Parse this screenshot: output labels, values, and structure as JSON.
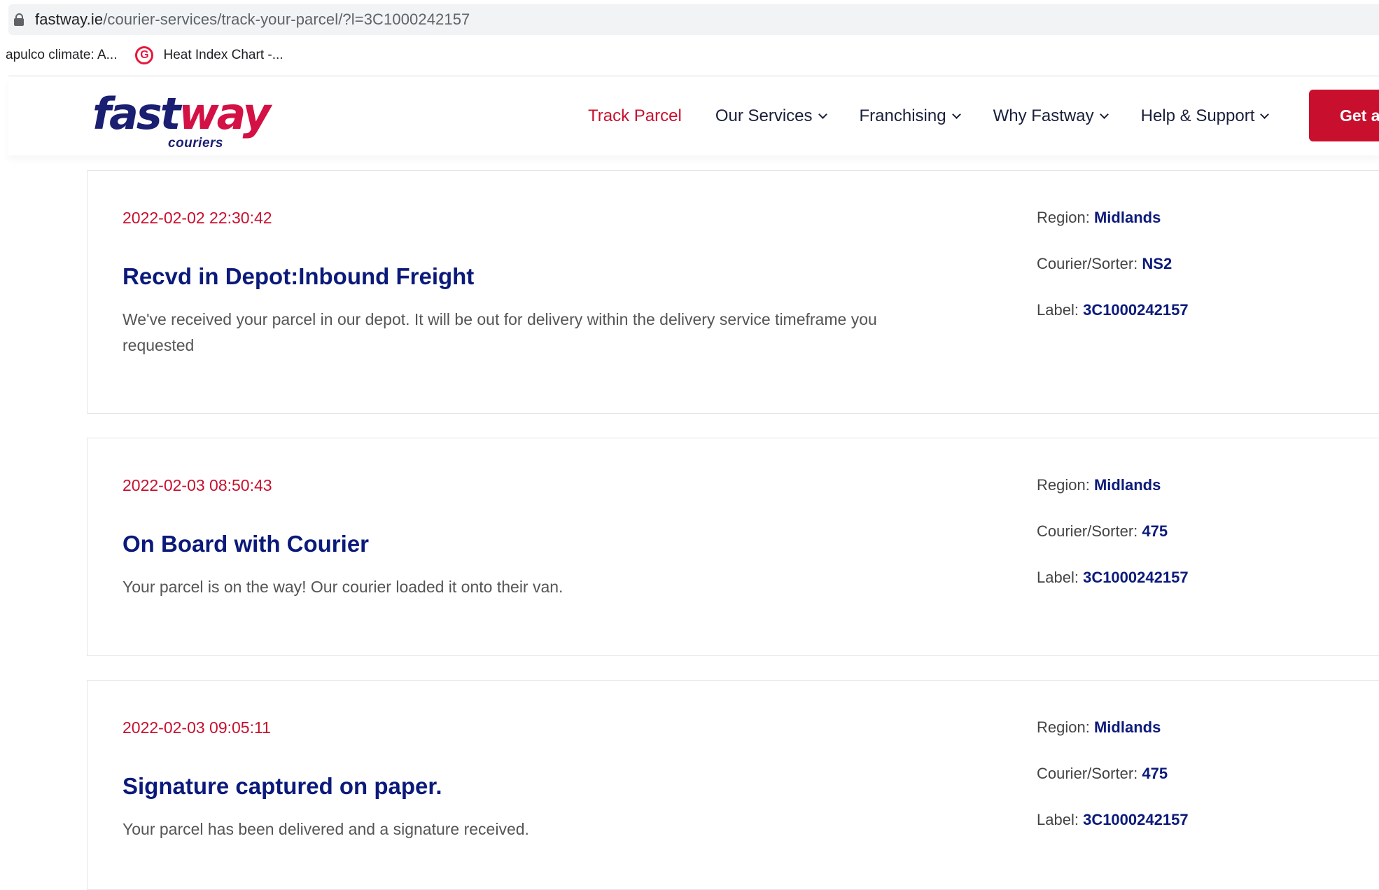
{
  "browser": {
    "url_domain": "fastway.ie",
    "url_path": "/courier-services/track-your-parcel/?l=3C1000242157",
    "bookmarks": [
      {
        "label": "apulco climate: A..."
      },
      {
        "label": "Heat Index Chart -..."
      }
    ]
  },
  "header": {
    "logo_word_a": "fast",
    "logo_word_b": "way",
    "logo_sub": "couriers",
    "nav": [
      {
        "label": "Track Parcel",
        "active": true
      },
      {
        "label": "Our Services",
        "dropdown": true
      },
      {
        "label": "Franchising",
        "dropdown": true
      },
      {
        "label": "Why Fastway",
        "dropdown": true
      },
      {
        "label": "Help & Support",
        "dropdown": true
      }
    ],
    "cta_label": "Get a"
  },
  "labels": {
    "region": "Region:",
    "courier": "Courier/Sorter:",
    "label": "Label:"
  },
  "events": [
    {
      "timestamp": "2022-02-02 22:30:42",
      "title": "Recvd in Depot:Inbound Freight",
      "description": "We've received your parcel in our depot. It will be out for delivery within the delivery service timeframe you requested",
      "region": "Midlands",
      "courier": "NS2",
      "label": "3C1000242157"
    },
    {
      "timestamp": "2022-02-03 08:50:43",
      "title": "On Board with Courier",
      "description": "Your parcel is on the way! Our courier loaded it onto their van.",
      "region": "Midlands",
      "courier": "475",
      "label": "3C1000242157"
    },
    {
      "timestamp": "2022-02-03 09:05:11",
      "title": "Signature captured on paper.",
      "description": "Your parcel has been delivered and a signature received.",
      "region": "Midlands",
      "courier": "475",
      "label": "3C1000242157"
    }
  ],
  "colors": {
    "brand_navy": "#1a1f71",
    "brand_red": "#c8102e"
  }
}
